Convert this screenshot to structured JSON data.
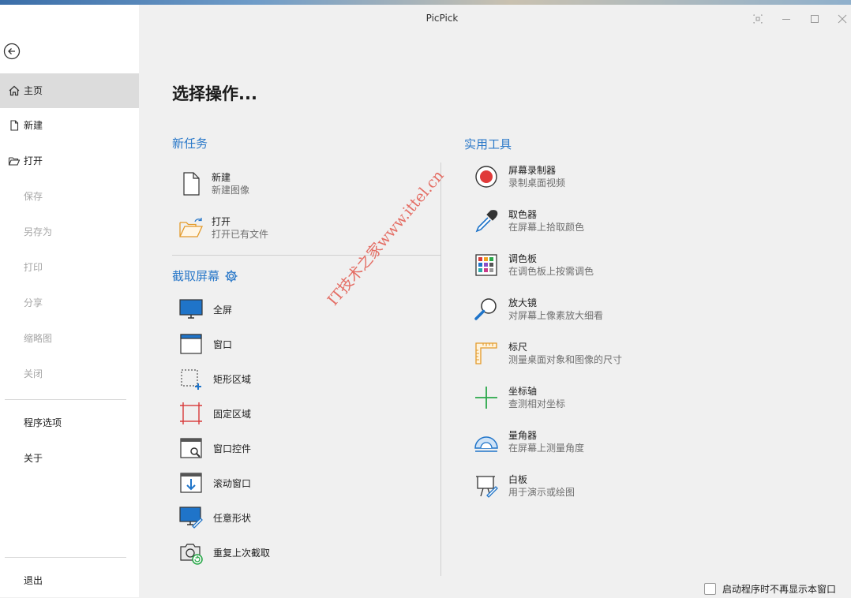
{
  "window": {
    "title": "PicPick"
  },
  "sidebar": {
    "items": [
      {
        "label": "主页"
      },
      {
        "label": "新建"
      },
      {
        "label": "打开"
      },
      {
        "label": "保存"
      },
      {
        "label": "另存为"
      },
      {
        "label": "打印"
      },
      {
        "label": "分享"
      },
      {
        "label": "缩略图"
      },
      {
        "label": "关闭"
      },
      {
        "label": "程序选项"
      },
      {
        "label": "关于"
      },
      {
        "label": "退出"
      }
    ]
  },
  "main": {
    "title": "选择操作...",
    "new_task": {
      "heading": "新任务",
      "items": [
        {
          "name": "新建",
          "desc": "新建图像",
          "icon": "blank-document-icon"
        },
        {
          "name": "打开",
          "desc": "打开已有文件",
          "icon": "open-folder-icon"
        }
      ]
    },
    "capture": {
      "heading": "截取屏幕",
      "items": [
        {
          "label": "全屏",
          "icon": "monitor-icon"
        },
        {
          "label": "窗口",
          "icon": "window-icon"
        },
        {
          "label": "矩形区域",
          "icon": "rectangle-region-icon"
        },
        {
          "label": "固定区域",
          "icon": "fixed-region-icon"
        },
        {
          "label": "窗口控件",
          "icon": "window-control-icon"
        },
        {
          "label": "滚动窗口",
          "icon": "scroll-window-icon"
        },
        {
          "label": "任意形状",
          "icon": "freehand-icon"
        },
        {
          "label": "重复上次截取",
          "icon": "repeat-capture-icon"
        }
      ]
    },
    "tools": {
      "heading": "实用工具",
      "items": [
        {
          "name": "屏幕录制器",
          "desc": "录制桌面视频",
          "icon": "record-icon"
        },
        {
          "name": "取色器",
          "desc": "在屏幕上拾取颜色",
          "icon": "eyedropper-icon"
        },
        {
          "name": "调色板",
          "desc": "在调色板上按需调色",
          "icon": "palette-icon"
        },
        {
          "name": "放大镜",
          "desc": "对屏幕上像素放大细看",
          "icon": "magnifier-icon"
        },
        {
          "name": "标尺",
          "desc": "测量桌面对象和图像的尺寸",
          "icon": "ruler-icon"
        },
        {
          "name": "坐标轴",
          "desc": "查测相对坐标",
          "icon": "crosshair-icon"
        },
        {
          "name": "量角器",
          "desc": "在屏幕上测量角度",
          "icon": "protractor-icon"
        },
        {
          "name": "白板",
          "desc": "用于演示或绘图",
          "icon": "whiteboard-icon"
        }
      ]
    }
  },
  "watermark": "IT技术之家www.ittel.cn",
  "footer": {
    "checkbox_label": "启动程序时不再显示本窗口",
    "checked": false
  },
  "colors": {
    "accent": "#2b79c9",
    "record": "#e03a3a",
    "watermark": "#e2574c"
  }
}
